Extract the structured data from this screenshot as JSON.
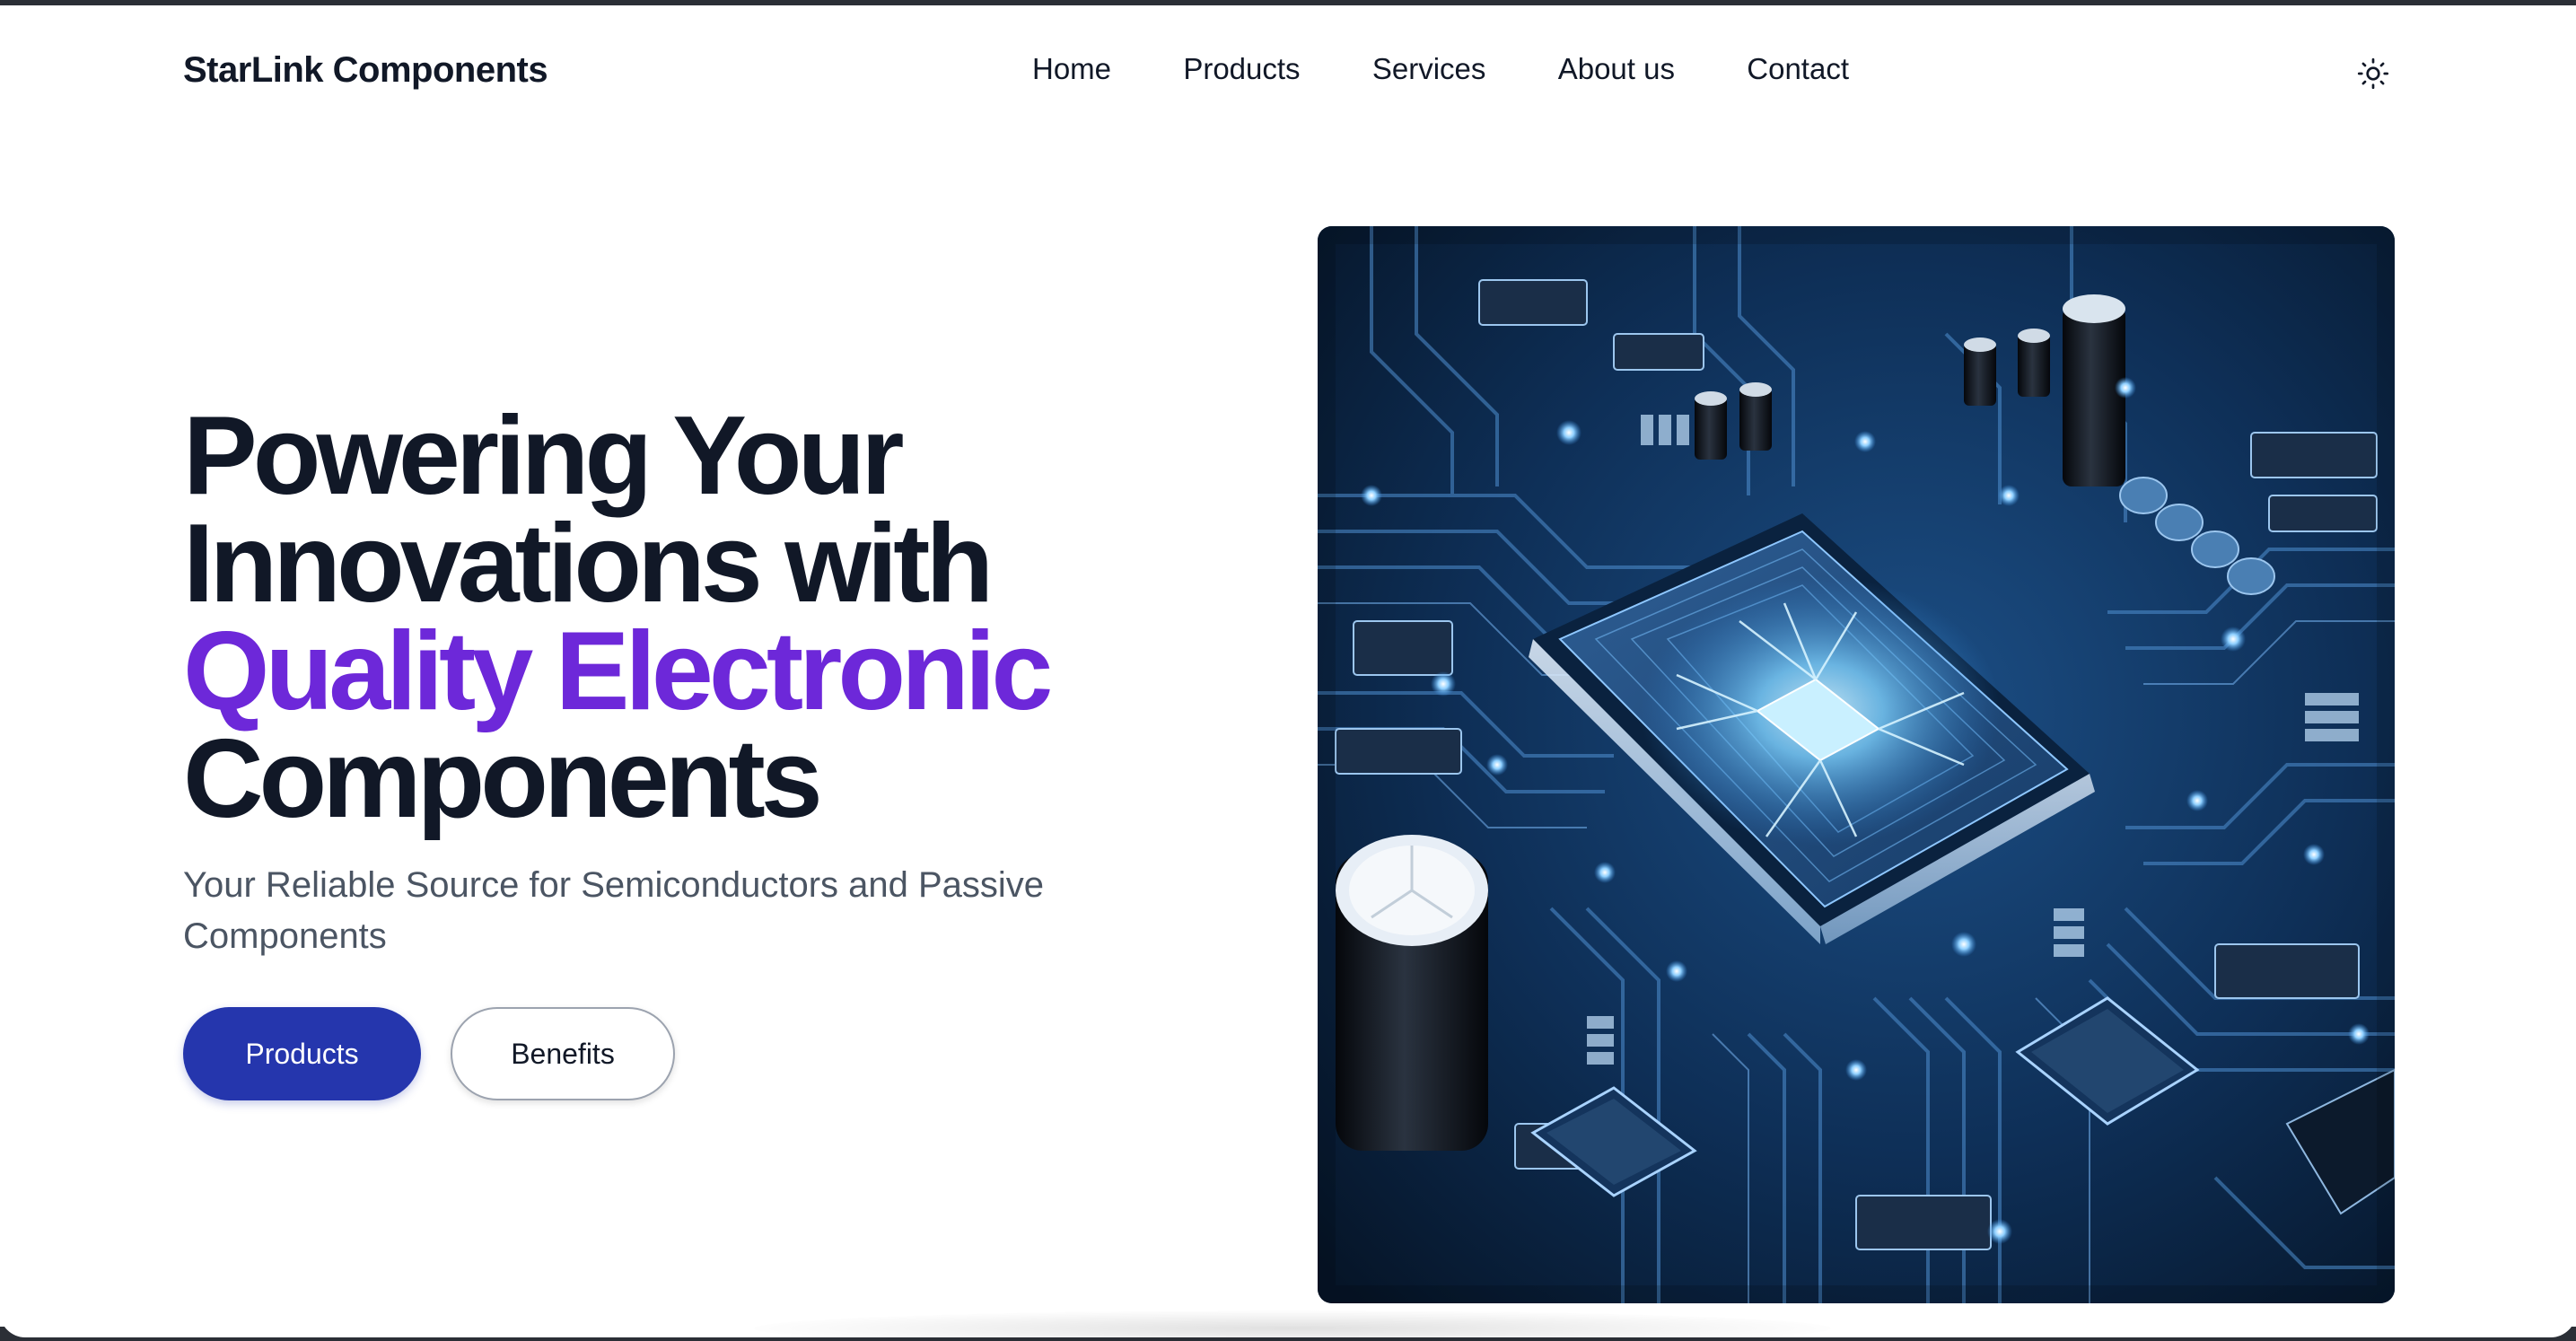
{
  "brand": {
    "name": "StarLink Components"
  },
  "nav": {
    "items": [
      {
        "label": "Home"
      },
      {
        "label": "Products"
      },
      {
        "label": "Services"
      },
      {
        "label": "About us"
      },
      {
        "label": "Contact"
      }
    ]
  },
  "theme_toggle": {
    "icon": "sun-icon"
  },
  "hero": {
    "headline": {
      "line1": "Powering Your",
      "line2": "Innovations with",
      "line3_accent": "Quality Electronic",
      "line4": "Components"
    },
    "subtitle": "Your Reliable Source for Semiconductors and Passive Components",
    "buttons": {
      "primary_label": "Products",
      "secondary_label": "Benefits"
    },
    "image": {
      "subject": "circuit-board-chip-image"
    }
  },
  "colors": {
    "accent_purple": "#6d28d9",
    "primary_button": "#2536ad",
    "text_dark": "#111827",
    "text_muted": "#4b5563",
    "board_blue": "#0c2d55",
    "trace_glow": "#5fb8ff"
  }
}
